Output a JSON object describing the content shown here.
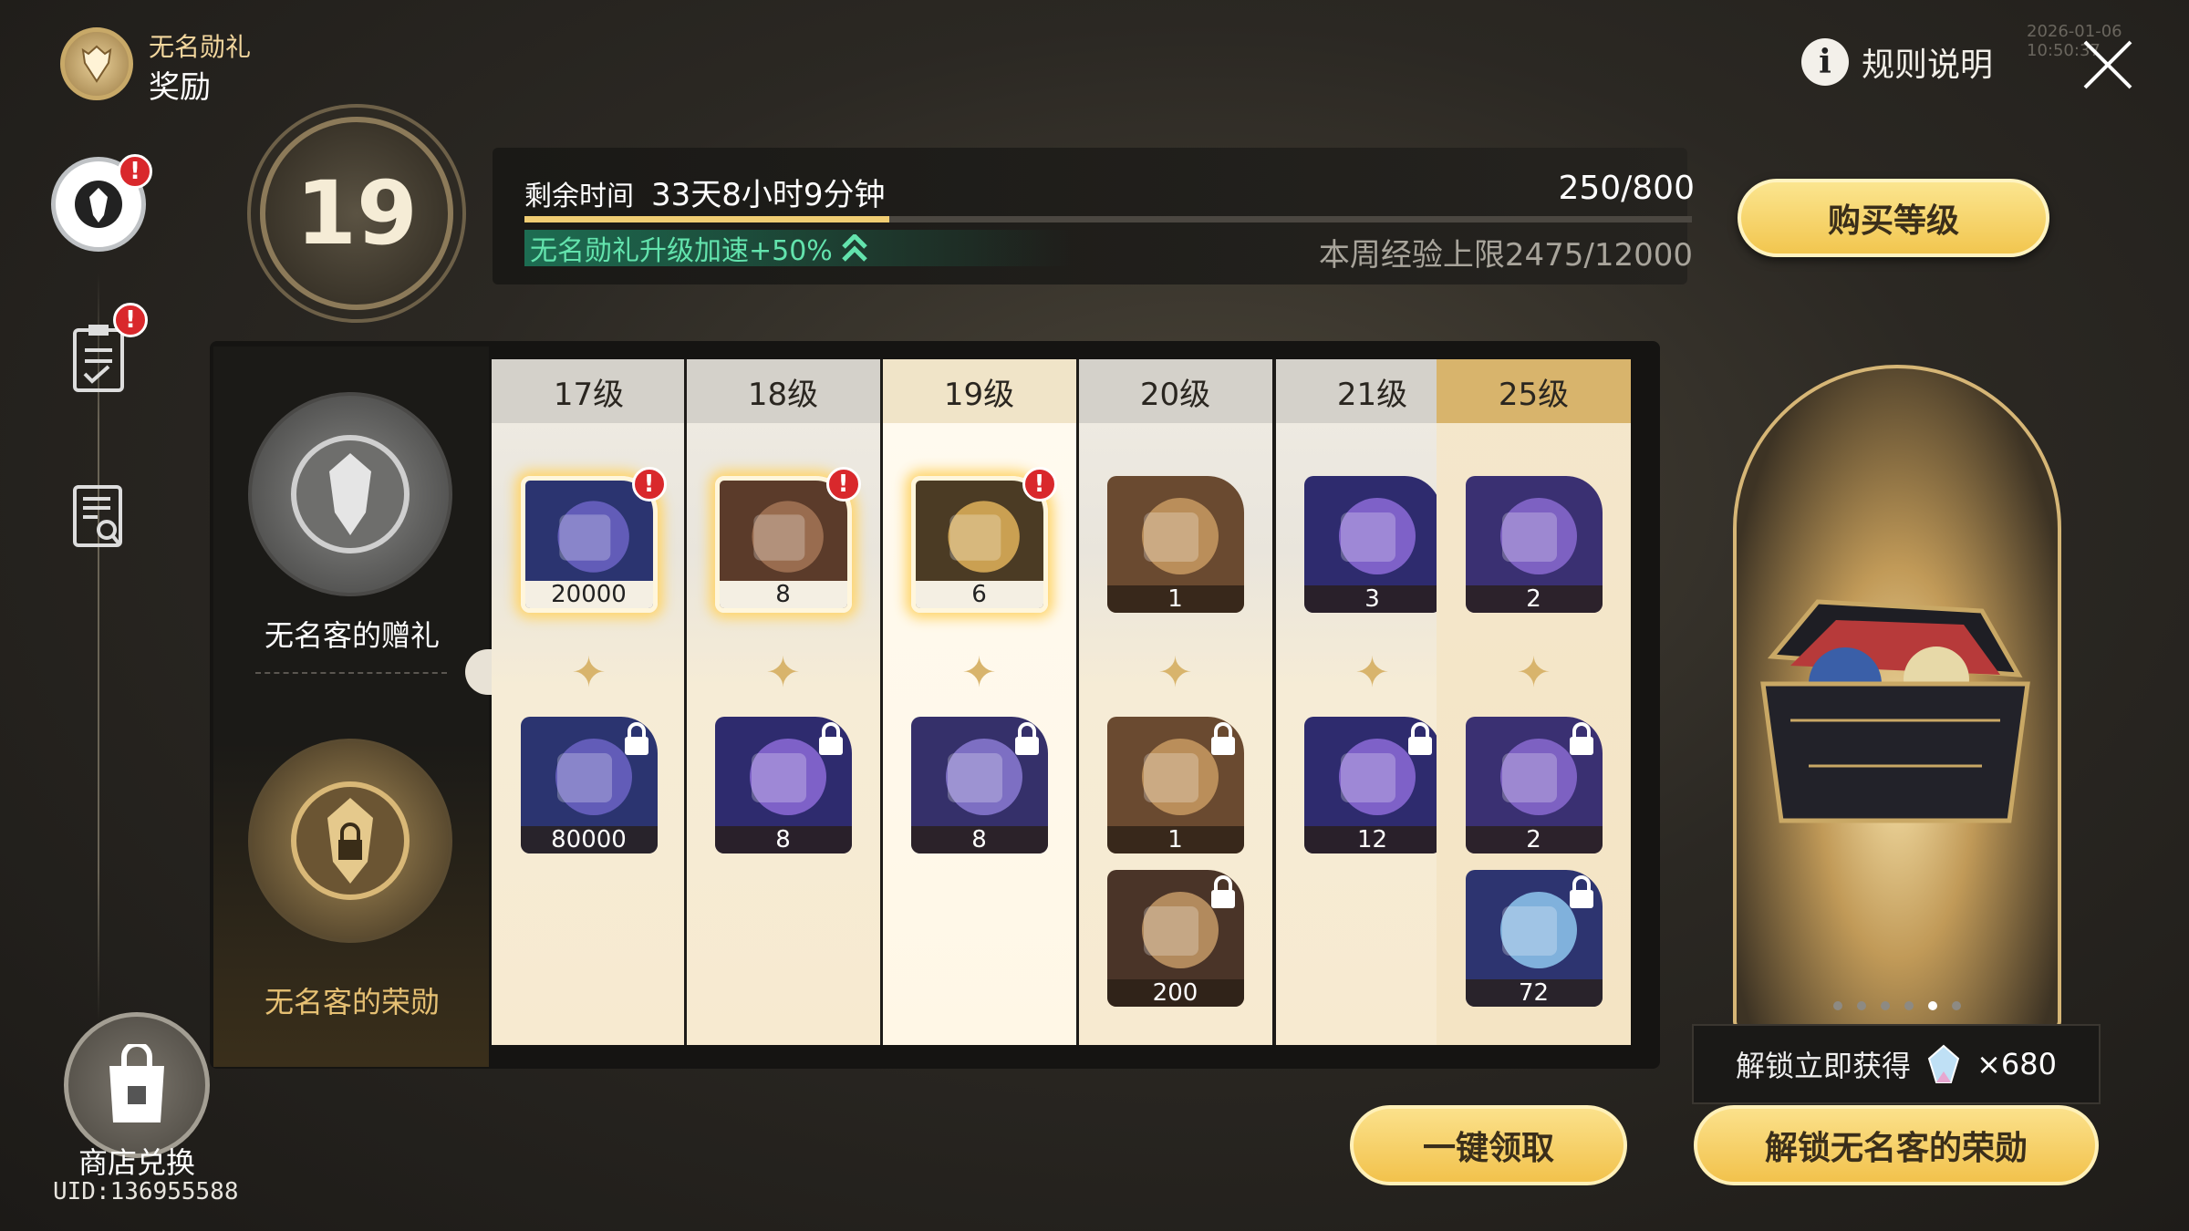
{
  "header": {
    "subtitle": "无名勋礼",
    "title": "奖励",
    "rules_label": "规则说明",
    "rules_icon": "info-icon",
    "close_icon": "close-icon",
    "watermark": "2026-01-06 10:50:37"
  },
  "sidebar": {
    "items": [
      {
        "icon": "honor-emblem-icon",
        "alert": "!"
      },
      {
        "icon": "mission-clipboard-icon",
        "alert": "!"
      },
      {
        "icon": "search-document-icon"
      }
    ],
    "shop": {
      "label": "商店兑换",
      "icon": "shopping-bag-icon"
    },
    "uid": "UID:136955588"
  },
  "level": {
    "current": "19",
    "remaining_label": "剩余时间",
    "remaining_value": "33天8小时9分钟",
    "exp": "250/800",
    "exp_fraction": 0.3125,
    "boost": "无名勋礼升级加速+50%",
    "weekly_cap": "本周经验上限2475/12000"
  },
  "buy_level_label": "购买等级",
  "tracks": {
    "free": "无名客的赠礼",
    "premium": "无名客的荣勋",
    "free_icon": "free-emblem-icon",
    "premium_icon": "premium-emblem-icon",
    "alert": "!"
  },
  "columns": [
    {
      "level": "17级",
      "free": [
        {
          "qty": "20000",
          "icon": "credit-card-icon",
          "ready": true
        }
      ],
      "premium": [
        {
          "qty": "80000",
          "icon": "credit-card-icon",
          "locked": true
        }
      ]
    },
    {
      "level": "18级",
      "free": [
        {
          "qty": "8",
          "icon": "brown-book-icon",
          "ready": true
        }
      ],
      "premium": [
        {
          "qty": "8",
          "icon": "purple-book-icon",
          "locked": true
        }
      ]
    },
    {
      "level": "19级",
      "free": [
        {
          "qty": "6",
          "icon": "gold-canister-icon",
          "ready": true
        }
      ],
      "premium": [
        {
          "qty": "8",
          "icon": "purple-canister-icon",
          "locked": true
        }
      ]
    },
    {
      "level": "20级",
      "free": [
        {
          "qty": "1",
          "icon": "pocket-watch-icon"
        }
      ],
      "premium": [
        {
          "qty": "1",
          "icon": "pocket-watch-icon",
          "locked": true
        },
        {
          "qty": "200",
          "icon": "card-deck-icon",
          "locked": true
        }
      ]
    },
    {
      "level": "21级",
      "free": [
        {
          "qty": "3",
          "icon": "purple-book-icon"
        }
      ],
      "premium": [
        {
          "qty": "12",
          "icon": "purple-book-icon",
          "locked": true
        }
      ]
    },
    {
      "level": "25级",
      "free": [
        {
          "qty": "2",
          "icon": "ribbon-bottle-icon"
        }
      ],
      "premium": [
        {
          "qty": "2",
          "icon": "ribbon-bottle-icon",
          "locked": true
        },
        {
          "qty": "72",
          "icon": "crystal-flask-icon",
          "locked": true
        }
      ]
    }
  ],
  "chest": {
    "icon": "treasure-chest-icon",
    "page_count": 6,
    "page_active": 5,
    "unlock_label": "解锁立即获得",
    "unlock_qty": "×680",
    "unlock_icon": "star-crystal-icon"
  },
  "buttons": {
    "claim_all": "一键领取",
    "unlock_premium": "解锁无名客的荣勋"
  },
  "colors": {
    "accent": "#f2c64f",
    "alert": "#d9282c",
    "boost": "#63e3ad",
    "premium": "#d8b46c"
  }
}
